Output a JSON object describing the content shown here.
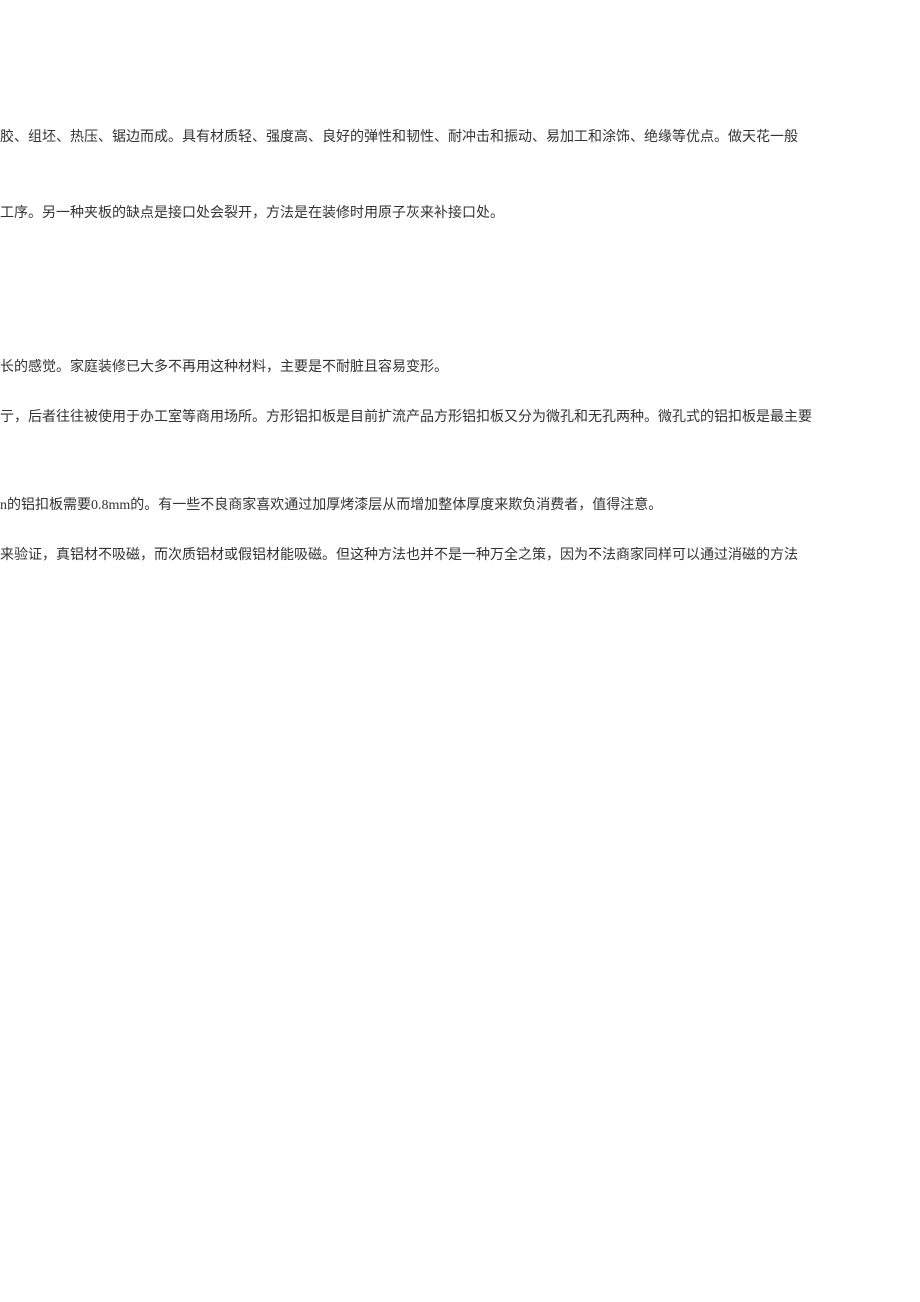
{
  "paragraphs": {
    "p1": "胶、组坯、热压、锯边而成。具有材质轻、强度高、良好的弹性和韧性、耐冲击和振动、易加工和涂饰、绝缘等优点。做天花一般",
    "p2": "工序。另一种夹板的缺点是接口处会裂开，方法是在装修时用原子灰来补接口处。",
    "p3": "长的感觉。家庭装修已大多不再用这种材料，主要是不耐脏且容易变形。",
    "p4": "亍，后者往往被使用于办工室等商用场所。方形铝扣板是目前扩流产品方形铝扣板又分为微孔和无孔两种。微孔式的铝扣板是最主要",
    "p5": "n的铝扣板需要0.8mm的。有一些不良商家喜欢通过加厚烤漆层从而增加整体厚度来欺负消费者，值得注意。",
    "p6": "来验证，真铝材不吸磁，而次质铝材或假铝材能吸磁。但这种方法也并不是一种万全之策，因为不法商家同样可以通过消磁的方法"
  }
}
